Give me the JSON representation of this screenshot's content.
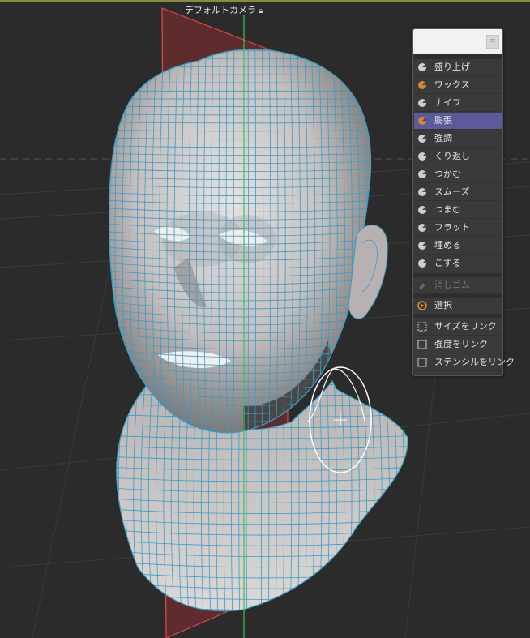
{
  "viewport": {
    "camera_title": "デフォルトカメラ",
    "camera_lock_icon": "lock-icon"
  },
  "brush_panel": {
    "menu_icon": "menu-icon",
    "brushes": [
      {
        "label": "盛り上げ",
        "icon": "sphere-brush-icon",
        "active": false
      },
      {
        "label": "ワックス",
        "icon": "wax-brush-icon",
        "active": false
      },
      {
        "label": "ナイフ",
        "icon": "knife-brush-icon",
        "active": false
      },
      {
        "label": "膨張",
        "icon": "inflate-brush-icon",
        "active": true
      },
      {
        "label": "強調",
        "icon": "pinch-brush-icon",
        "active": false
      },
      {
        "label": "くり返し",
        "icon": "repeat-brush-icon",
        "active": false
      },
      {
        "label": "つかむ",
        "icon": "grab-brush-icon",
        "active": false
      },
      {
        "label": "スムーズ",
        "icon": "smooth-brush-icon",
        "active": false
      },
      {
        "label": "つまむ",
        "icon": "pinch2-brush-icon",
        "active": false
      },
      {
        "label": "フラット",
        "icon": "flatten-brush-icon",
        "active": false
      },
      {
        "label": "埋める",
        "icon": "fill-brush-icon",
        "active": false
      },
      {
        "label": "こする",
        "icon": "scrape-brush-icon",
        "active": false
      }
    ],
    "eraser": {
      "label": "消しゴム",
      "icon": "eraser-icon",
      "disabled": true
    },
    "select": {
      "label": "選択",
      "icon": "select-icon"
    },
    "links": [
      {
        "label": "サイズをリンク",
        "icon": "link-size-icon"
      },
      {
        "label": "強度をリンク",
        "icon": "link-strength-icon"
      },
      {
        "label": "ステンシルをリンク",
        "icon": "link-stencil-icon"
      }
    ]
  },
  "colors": {
    "mesh_wire": "#3a9cc4",
    "active_item": "#5a5a9c",
    "symmetry_plane": "#c0393b",
    "axis_green": "#3fbf55"
  }
}
